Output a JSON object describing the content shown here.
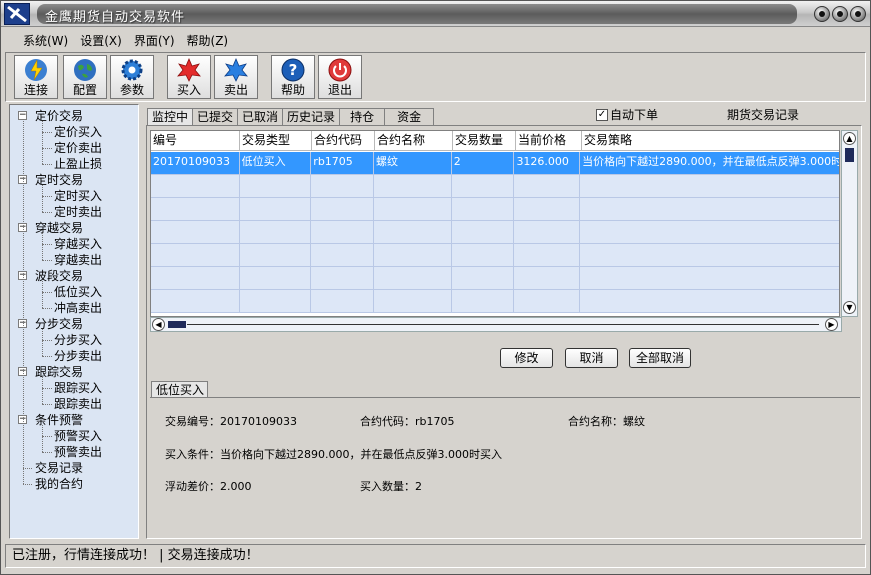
{
  "window": {
    "title": "金鹰期货自动交易软件"
  },
  "menu": [
    "系统(W)",
    "设置(X)",
    "界面(Y)",
    "帮助(Z)"
  ],
  "toolbar": [
    "连接",
    "配置",
    "参数",
    "买入",
    "卖出",
    "帮助",
    "退出"
  ],
  "tree": [
    {
      "label": "定价交易",
      "children": [
        "定价买入",
        "定价卖出",
        "止盈止损"
      ]
    },
    {
      "label": "定时交易",
      "children": [
        "定时买入",
        "定时卖出"
      ]
    },
    {
      "label": "穿越交易",
      "children": [
        "穿越买入",
        "穿越卖出"
      ]
    },
    {
      "label": "波段交易",
      "children": [
        "低位买入",
        "冲高卖出"
      ]
    },
    {
      "label": "分步交易",
      "children": [
        "分步买入",
        "分步卖出"
      ]
    },
    {
      "label": "跟踪交易",
      "children": [
        "跟踪买入",
        "跟踪卖出"
      ]
    },
    {
      "label": "条件预警",
      "children": [
        "预警买入",
        "预警卖出"
      ]
    },
    {
      "label": "交易记录",
      "children": []
    },
    {
      "label": "我的合约",
      "children": []
    }
  ],
  "tabs": [
    "监控中",
    "已提交",
    "已取消",
    "历史记录",
    "持仓",
    "资金"
  ],
  "auto_order": {
    "label": "自动下单",
    "checked": true
  },
  "records_label": "期货交易记录",
  "grid": {
    "columns": [
      "编号",
      "交易类型",
      "合约代码",
      "合约名称",
      "交易数量",
      "当前价格",
      "交易策略"
    ],
    "rows": [
      [
        "20170109033",
        "低位买入",
        "rb1705",
        "螺纹",
        "2",
        "3126.000",
        "当价格向下越过2890.000，并在最低点反弹3.000时买入"
      ]
    ],
    "empty_rows": 6
  },
  "actions": [
    "修改",
    "取消",
    "全部取消"
  ],
  "detail": {
    "tab": "低位买入",
    "trade_no": "交易编号：20170109033",
    "contract_code": "合约代码：rb1705",
    "contract_name": "合约名称：螺纹",
    "condition": "买入条件：当价格向下越过2890.000，并在最低点反弹3.000时买入",
    "float_diff": "浮动差价：2.000",
    "quantity": "买入数量：2"
  },
  "status": "已注册，行情连接成功！ | 交易连接成功！"
}
